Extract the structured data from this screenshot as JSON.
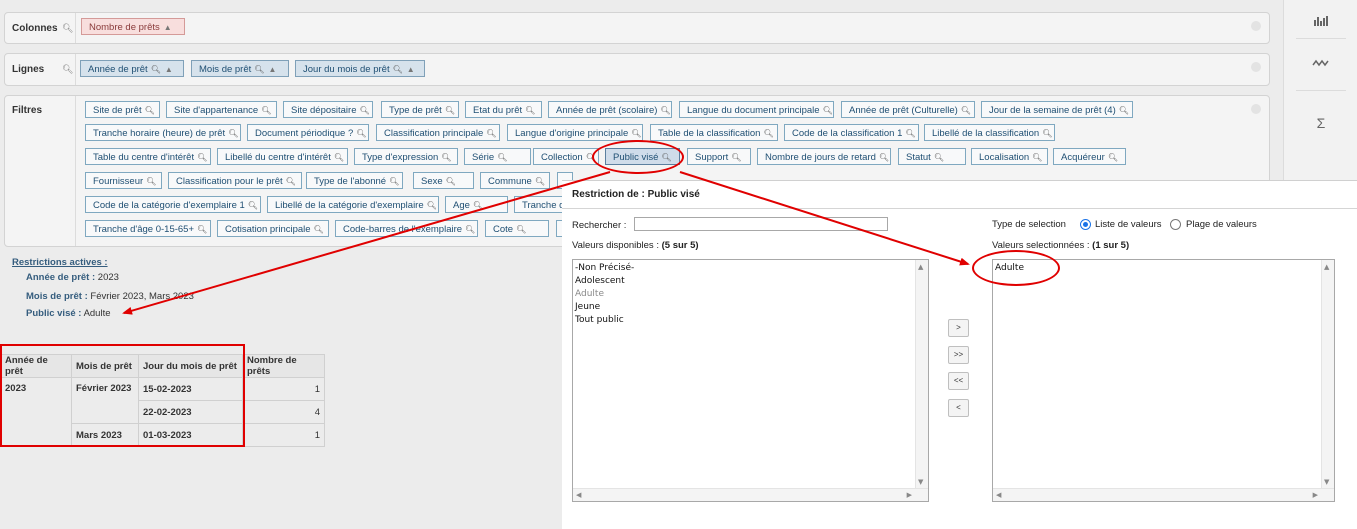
{
  "panels": {
    "colonnes_title": "Colonnes",
    "lignes_title": "Lignes",
    "filtres_title": "Filtres"
  },
  "colonnes_chips": [
    "Nombre de prêts"
  ],
  "lignes_chips": [
    "Année de prêt",
    "Mois de prêt",
    "Jour du mois de prêt"
  ],
  "filtres_chips": [
    "Site de prêt",
    "Site d'appartenance",
    "Site dépositaire",
    "Type de prêt",
    "Etat du prêt",
    "Année de prêt (scolaire)",
    "Langue du document principale",
    "Année de prêt (Culturelle)",
    "Jour de la semaine de prêt (4)",
    "Tranche horaire (heure) de prêt",
    "Document périodique ?",
    "Classification principale",
    "Langue d'origine principale",
    "Table de la classification",
    "Code de la classification 1",
    "Libellé de la classification",
    "Table du centre d'intérêt",
    "Libellé du centre d'intérêt",
    "Type d'expression",
    "Série",
    "Collection",
    "Public visé",
    "Support",
    "Nombre de jours de retard",
    "Statut",
    "Localisation",
    "Acquéreur",
    "Fournisseur",
    "Classification pour le prêt",
    "Type de l'abonné",
    "Sexe",
    "Commune",
    "",
    "Code de la catégorie d'exemplaire 1",
    "Libellé de la catégorie d'exemplaire",
    "Age",
    "Tranche d'",
    "Tranche d'âge 0-15-65+",
    "Cotisation principale",
    "Code-barres de l'exemplaire",
    "Cote",
    ""
  ],
  "restrictions": {
    "title": "Restrictions actives :",
    "items": [
      {
        "label": "Année de prêt :",
        "value": "2023"
      },
      {
        "label": "Mois de prêt :",
        "value": "Février 2023, Mars 2023"
      },
      {
        "label": "Public visé :",
        "value": "Adulte"
      }
    ]
  },
  "table": {
    "headers": [
      "Année de prêt",
      "Mois de prêt",
      "Jour du mois de prêt",
      "Nombre de prêts"
    ],
    "rows": [
      [
        "2023",
        "Février 2023",
        "15-02-2023",
        "1"
      ],
      [
        "",
        "",
        "22-02-2023",
        "4"
      ],
      [
        "",
        "Mars 2023",
        "01-03-2023",
        "1"
      ]
    ]
  },
  "dialog": {
    "title": "Restriction de : Public visé",
    "search_label": "Rechercher :",
    "search_value": "",
    "available_label": "Valeurs disponibles :",
    "available_count": "(5 sur 5)",
    "available": [
      "-Non Précisé-",
      "Adolescent",
      "Adulte",
      "Jeune",
      "Tout public"
    ],
    "selection_type_label": "Type de selection",
    "radio_list": "Liste de valeurs",
    "radio_range": "Plage de valeurs",
    "selected_label": "Valeurs selectionnées :",
    "selected_count": "(1 sur 5)",
    "selected": [
      "Adulte"
    ],
    "btn_add": ">",
    "btn_add_all": ">>",
    "btn_remove_all": "<<",
    "btn_remove": "<"
  },
  "sidebar": {
    "icon1": "bar-chart-icon",
    "icon2": "line-chart-icon",
    "icon3": "sum-icon",
    "sum_symbol": "Σ"
  },
  "colors": {
    "accent": "#1a73e8",
    "annotation": "#e00000"
  }
}
